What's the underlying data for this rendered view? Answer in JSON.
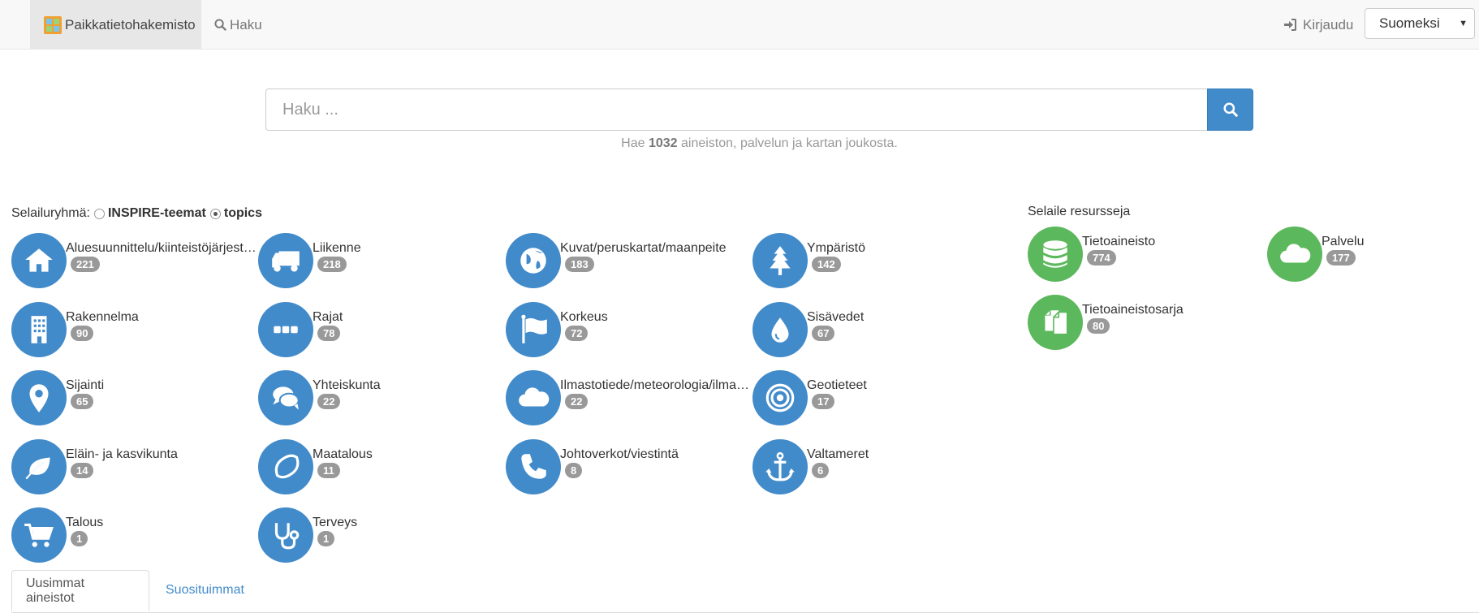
{
  "navbar": {
    "brand": "Paikkatietohakemisto",
    "search_link": "Haku",
    "login": "Kirjaudu",
    "language": "Suomeksi"
  },
  "search": {
    "placeholder": "Haku ...",
    "hint_prefix": "Hae",
    "hint_count": "1032",
    "hint_suffix": "aineiston, palvelun ja kartan joukosta."
  },
  "browse": {
    "label": "Selailuryhmä:",
    "option_inspire": "INSPIRE-teemat",
    "option_topics": "topics",
    "selected": "topics"
  },
  "topics": [
    {
      "label": "Aluesuunnittelu/kiinteistöjärjestelmät",
      "count": "221",
      "icon": "home-icon"
    },
    {
      "label": "Liikenne",
      "count": "218",
      "icon": "truck-icon"
    },
    {
      "label": "Kuvat/peruskartat/maanpeite",
      "count": "183",
      "icon": "globe-icon"
    },
    {
      "label": "Ympäristö",
      "count": "142",
      "icon": "tree-icon"
    },
    {
      "label": "Rakennelma",
      "count": "90",
      "icon": "building-icon"
    },
    {
      "label": "Rajat",
      "count": "78",
      "icon": "ellipsis-icon"
    },
    {
      "label": "Korkeus",
      "count": "72",
      "icon": "flag-icon"
    },
    {
      "label": "Sisävedet",
      "count": "67",
      "icon": "water-drop-icon"
    },
    {
      "label": "Sijainti",
      "count": "65",
      "icon": "map-marker-icon"
    },
    {
      "label": "Yhteiskunta",
      "count": "22",
      "icon": "comments-icon"
    },
    {
      "label": "Ilmastotiede/meteorologia/ilmakehä",
      "count": "22",
      "icon": "cloud-icon"
    },
    {
      "label": "Geotieteet",
      "count": "17",
      "icon": "bullseye-icon"
    },
    {
      "label": "Eläin- ja kasvikunta",
      "count": "14",
      "icon": "leaf-icon"
    },
    {
      "label": "Maatalous",
      "count": "11",
      "icon": "lemon-icon"
    },
    {
      "label": "Johtoverkot/viestintä",
      "count": "8",
      "icon": "phone-icon"
    },
    {
      "label": "Valtameret",
      "count": "6",
      "icon": "anchor-icon"
    },
    {
      "label": "Talous",
      "count": "1",
      "icon": "shopping-cart-icon"
    },
    {
      "label": "Terveys",
      "count": "1",
      "icon": "stethoscope-icon"
    }
  ],
  "resources": {
    "title": "Selaile resursseja",
    "items": [
      {
        "label": "Tietoaineisto",
        "count": "774",
        "icon": "database-icon"
      },
      {
        "label": "Palvelu",
        "count": "177",
        "icon": "cloud-icon"
      },
      {
        "label": "Tietoaineistosarja",
        "count": "80",
        "icon": "copy-icon"
      }
    ]
  },
  "tabs": [
    {
      "label": "Uusimmat aineistot",
      "active": true
    },
    {
      "label": "Suosituimmat",
      "active": false
    }
  ],
  "colors": {
    "primary": "#428bca",
    "resource": "#5cb85c",
    "badge": "#999999"
  }
}
